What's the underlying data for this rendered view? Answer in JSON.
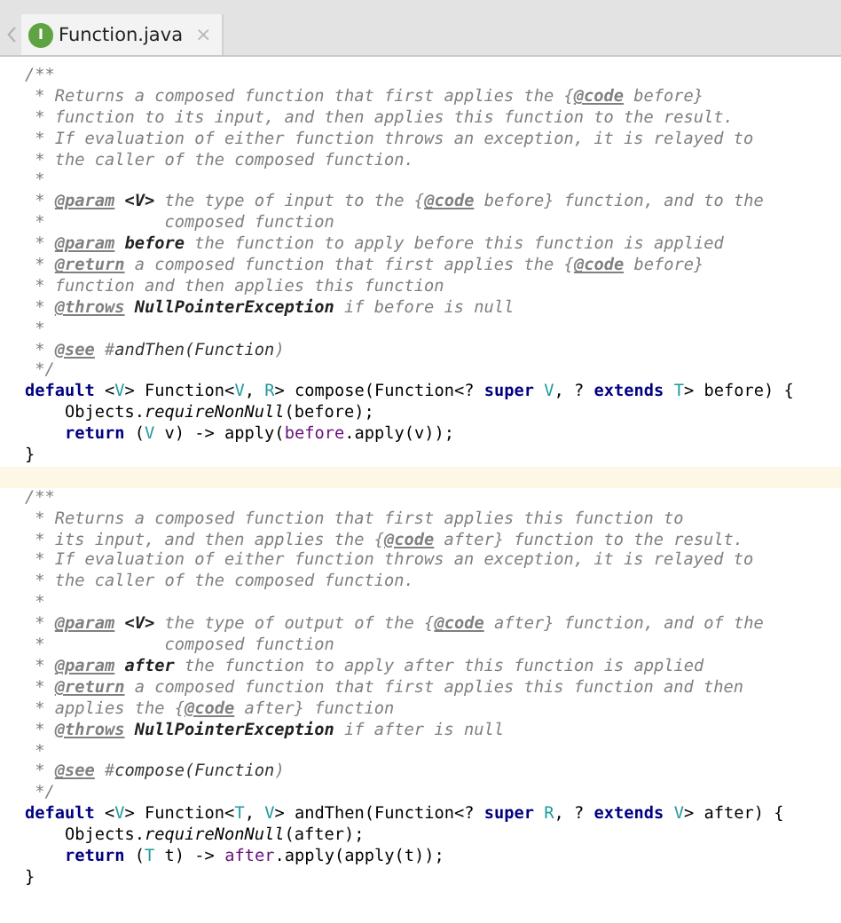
{
  "tabs": [
    {
      "label": "Function.java",
      "icon_letter": "I",
      "close": "×",
      "selected": true
    }
  ],
  "editor": {
    "lines": [
      {
        "highlighted": false,
        "segments": [
          {
            "kind": "comment",
            "text": "/**"
          }
        ]
      },
      {
        "highlighted": false,
        "segments": [
          {
            "kind": "comment",
            "text": " * Returns a composed function that first applies the {"
          },
          {
            "kind": "tag",
            "text": "@code"
          },
          {
            "kind": "comment",
            "text": " before}"
          }
        ]
      },
      {
        "highlighted": false,
        "segments": [
          {
            "kind": "comment",
            "text": " * function to its input, and then applies this function to the result."
          }
        ]
      },
      {
        "highlighted": false,
        "segments": [
          {
            "kind": "comment",
            "text": " * If evaluation of either function throws an exception, it is relayed to"
          }
        ]
      },
      {
        "highlighted": false,
        "segments": [
          {
            "kind": "comment",
            "text": " * the caller of the composed function."
          }
        ]
      },
      {
        "highlighted": false,
        "segments": [
          {
            "kind": "comment",
            "text": " *"
          }
        ]
      },
      {
        "highlighted": false,
        "segments": [
          {
            "kind": "comment",
            "text": " * "
          },
          {
            "kind": "tag",
            "text": "@param"
          },
          {
            "kind": "ref",
            "text": " <V>"
          },
          {
            "kind": "comment",
            "text": " the type of input to the {"
          },
          {
            "kind": "tag",
            "text": "@code"
          },
          {
            "kind": "comment",
            "text": " before} function, and to the"
          }
        ]
      },
      {
        "highlighted": false,
        "segments": [
          {
            "kind": "comment",
            "text": " *            composed function"
          }
        ]
      },
      {
        "highlighted": false,
        "segments": [
          {
            "kind": "comment",
            "text": " * "
          },
          {
            "kind": "tag",
            "text": "@param"
          },
          {
            "kind": "ref",
            "text": " before"
          },
          {
            "kind": "comment",
            "text": " the function to apply before this function is applied"
          }
        ]
      },
      {
        "highlighted": false,
        "segments": [
          {
            "kind": "comment",
            "text": " * "
          },
          {
            "kind": "tag",
            "text": "@return"
          },
          {
            "kind": "comment",
            "text": " a composed function that first applies the {"
          },
          {
            "kind": "tag",
            "text": "@code"
          },
          {
            "kind": "comment",
            "text": " before}"
          }
        ]
      },
      {
        "highlighted": false,
        "segments": [
          {
            "kind": "comment",
            "text": " * function and then applies this function"
          }
        ]
      },
      {
        "highlighted": false,
        "segments": [
          {
            "kind": "comment",
            "text": " * "
          },
          {
            "kind": "tag",
            "text": "@throws"
          },
          {
            "kind": "ref",
            "text": " NullPointerException"
          },
          {
            "kind": "comment",
            "text": " if before is null"
          }
        ]
      },
      {
        "highlighted": false,
        "segments": [
          {
            "kind": "comment",
            "text": " *"
          }
        ]
      },
      {
        "highlighted": false,
        "segments": [
          {
            "kind": "comment",
            "text": " * "
          },
          {
            "kind": "tag",
            "text": "@see"
          },
          {
            "kind": "comment",
            "text": " #"
          },
          {
            "kind": "link",
            "text": "andThen(Function"
          },
          {
            "kind": "comment",
            "text": ")"
          }
        ]
      },
      {
        "highlighted": false,
        "segments": [
          {
            "kind": "comment",
            "text": " */"
          }
        ]
      },
      {
        "highlighted": false,
        "segments": [
          {
            "kind": "keyword",
            "text": "default"
          },
          {
            "kind": "plain",
            "text": " <"
          },
          {
            "kind": "type_param",
            "text": "V"
          },
          {
            "kind": "plain",
            "text": "> Function<"
          },
          {
            "kind": "type_param",
            "text": "V"
          },
          {
            "kind": "plain",
            "text": ", "
          },
          {
            "kind": "type_param",
            "text": "R"
          },
          {
            "kind": "plain",
            "text": "> compose(Function<? "
          },
          {
            "kind": "keyword",
            "text": "super"
          },
          {
            "kind": "type_param",
            "text": " V"
          },
          {
            "kind": "plain",
            "text": ", ? "
          },
          {
            "kind": "keyword",
            "text": "extends"
          },
          {
            "kind": "type_param",
            "text": " T"
          },
          {
            "kind": "plain",
            "text": "> before) {"
          }
        ]
      },
      {
        "highlighted": false,
        "segments": [
          {
            "kind": "plain",
            "text": "    Objects."
          },
          {
            "kind": "static",
            "text": "requireNonNull"
          },
          {
            "kind": "plain",
            "text": "(before);"
          }
        ]
      },
      {
        "highlighted": false,
        "segments": [
          {
            "kind": "keyword",
            "text": "    return"
          },
          {
            "kind": "plain",
            "text": " ("
          },
          {
            "kind": "type_param",
            "text": "V"
          },
          {
            "kind": "plain",
            "text": " v) -> apply("
          },
          {
            "kind": "field",
            "text": "before"
          },
          {
            "kind": "plain",
            "text": ".apply(v));"
          }
        ]
      },
      {
        "highlighted": false,
        "segments": [
          {
            "kind": "plain",
            "text": "}"
          }
        ]
      },
      {
        "highlighted": true
      },
      {
        "highlighted": false,
        "segments": [
          {
            "kind": "comment",
            "text": "/**"
          }
        ]
      },
      {
        "highlighted": false,
        "segments": [
          {
            "kind": "comment",
            "text": " * Returns a composed function that first applies this function to"
          }
        ]
      },
      {
        "highlighted": false,
        "segments": [
          {
            "kind": "comment",
            "text": " * its input, and then applies the {"
          },
          {
            "kind": "tag",
            "text": "@code"
          },
          {
            "kind": "comment",
            "text": " after} function to the result."
          }
        ]
      },
      {
        "highlighted": false,
        "segments": [
          {
            "kind": "comment",
            "text": " * If evaluation of either function throws an exception, it is relayed to"
          }
        ]
      },
      {
        "highlighted": false,
        "segments": [
          {
            "kind": "comment",
            "text": " * the caller of the composed function."
          }
        ]
      },
      {
        "highlighted": false,
        "segments": [
          {
            "kind": "comment",
            "text": " *"
          }
        ]
      },
      {
        "highlighted": false,
        "segments": [
          {
            "kind": "comment",
            "text": " * "
          },
          {
            "kind": "tag",
            "text": "@param"
          },
          {
            "kind": "ref",
            "text": " <V>"
          },
          {
            "kind": "comment",
            "text": " the type of output of the {"
          },
          {
            "kind": "tag",
            "text": "@code"
          },
          {
            "kind": "comment",
            "text": " after} function, and of the"
          }
        ]
      },
      {
        "highlighted": false,
        "segments": [
          {
            "kind": "comment",
            "text": " *            composed function"
          }
        ]
      },
      {
        "highlighted": false,
        "segments": [
          {
            "kind": "comment",
            "text": " * "
          },
          {
            "kind": "tag",
            "text": "@param"
          },
          {
            "kind": "ref",
            "text": " after"
          },
          {
            "kind": "comment",
            "text": " the function to apply after this function is applied"
          }
        ]
      },
      {
        "highlighted": false,
        "segments": [
          {
            "kind": "comment",
            "text": " * "
          },
          {
            "kind": "tag",
            "text": "@return"
          },
          {
            "kind": "comment",
            "text": " a composed function that first applies this function and then"
          }
        ]
      },
      {
        "highlighted": false,
        "segments": [
          {
            "kind": "comment",
            "text": " * applies the {"
          },
          {
            "kind": "tag",
            "text": "@code"
          },
          {
            "kind": "comment",
            "text": " after} function"
          }
        ]
      },
      {
        "highlighted": false,
        "segments": [
          {
            "kind": "comment",
            "text": " * "
          },
          {
            "kind": "tag",
            "text": "@throws"
          },
          {
            "kind": "ref",
            "text": " NullPointerException"
          },
          {
            "kind": "comment",
            "text": " if after is null"
          }
        ]
      },
      {
        "highlighted": false,
        "segments": [
          {
            "kind": "comment",
            "text": " *"
          }
        ]
      },
      {
        "highlighted": false,
        "segments": [
          {
            "kind": "comment",
            "text": " * "
          },
          {
            "kind": "tag",
            "text": "@see"
          },
          {
            "kind": "comment",
            "text": " #"
          },
          {
            "kind": "link",
            "text": "compose(Function"
          },
          {
            "kind": "comment",
            "text": ")"
          }
        ]
      },
      {
        "highlighted": false,
        "segments": [
          {
            "kind": "comment",
            "text": " */"
          }
        ]
      },
      {
        "highlighted": false,
        "segments": [
          {
            "kind": "keyword",
            "text": "default"
          },
          {
            "kind": "plain",
            "text": " <"
          },
          {
            "kind": "type_param",
            "text": "V"
          },
          {
            "kind": "plain",
            "text": "> Function<"
          },
          {
            "kind": "type_param",
            "text": "T"
          },
          {
            "kind": "plain",
            "text": ", "
          },
          {
            "kind": "type_param",
            "text": "V"
          },
          {
            "kind": "plain",
            "text": "> andThen(Function<? "
          },
          {
            "kind": "keyword",
            "text": "super"
          },
          {
            "kind": "type_param",
            "text": " R"
          },
          {
            "kind": "plain",
            "text": ", ? "
          },
          {
            "kind": "keyword",
            "text": "extends"
          },
          {
            "kind": "type_param",
            "text": " V"
          },
          {
            "kind": "plain",
            "text": "> after) {"
          }
        ]
      },
      {
        "highlighted": false,
        "segments": [
          {
            "kind": "plain",
            "text": "    Objects."
          },
          {
            "kind": "static",
            "text": "requireNonNull"
          },
          {
            "kind": "plain",
            "text": "(after);"
          }
        ]
      },
      {
        "highlighted": false,
        "segments": [
          {
            "kind": "keyword",
            "text": "    return"
          },
          {
            "kind": "plain",
            "text": " ("
          },
          {
            "kind": "type_param",
            "text": "T"
          },
          {
            "kind": "plain",
            "text": " t) -> "
          },
          {
            "kind": "field",
            "text": "after"
          },
          {
            "kind": "plain",
            "text": ".apply(apply(t));"
          }
        ]
      },
      {
        "highlighted": false,
        "segments": [
          {
            "kind": "plain",
            "text": "}"
          }
        ]
      }
    ]
  }
}
